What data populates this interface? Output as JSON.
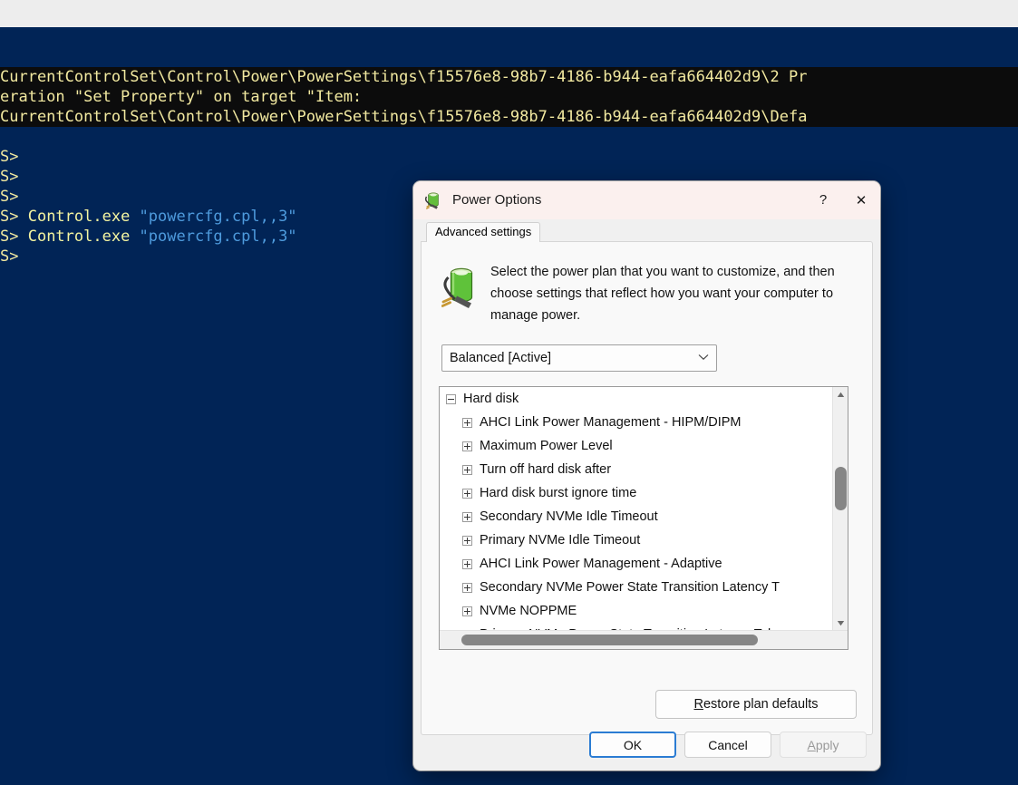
{
  "console": {
    "lines": [
      {
        "type": "error",
        "text": "CurrentControlSet\\Control\\Power\\PowerSettings\\f15576e8-98b7-4186-b944-eafa664402d9\\2 Pr"
      },
      {
        "type": "error",
        "text": "eration \"Set Property\" on target \"Item:"
      },
      {
        "type": "error",
        "text": "CurrentControlSet\\Control\\Power\\PowerSettings\\f15576e8-98b7-4186-b944-eafa664402d9\\Defa"
      },
      {
        "type": "blank",
        "text": ""
      },
      {
        "type": "prompt",
        "prompt": "S>",
        "command": "",
        "arg": ""
      },
      {
        "type": "prompt",
        "prompt": "S>",
        "command": "",
        "arg": ""
      },
      {
        "type": "prompt",
        "prompt": "S>",
        "command": "",
        "arg": ""
      },
      {
        "type": "prompt",
        "prompt": "S>",
        "command": " Control.exe ",
        "arg": "\"powercfg.cpl,,3\""
      },
      {
        "type": "prompt",
        "prompt": "S>",
        "command": " Control.exe ",
        "arg": "\"powercfg.cpl,,3\""
      },
      {
        "type": "prompt",
        "prompt": "S>",
        "command": "",
        "arg": ""
      }
    ],
    "colors": {
      "background": "#012456",
      "error_background": "#0c0c0c",
      "error_text": "#f2e9a0",
      "prompt_text": "#f2e9a0",
      "command_text": "#f4f4a0",
      "argument_text": "#4e9bdd"
    }
  },
  "dialog": {
    "title": "Power Options",
    "icon": "power-plan-icon",
    "titlebar": {
      "help_label": "?",
      "close_label": "✕"
    },
    "tabs": [
      {
        "label": "Advanced settings",
        "selected": true
      }
    ],
    "description": "Select the power plan that you want to customize, and then choose settings that reflect how you want your computer to manage power.",
    "plan_select": {
      "value": "Balanced [Active]",
      "arrow": "⌄",
      "options": [
        "Balanced [Active]"
      ]
    },
    "tree": {
      "items": [
        {
          "label": "Hard disk",
          "level": 0,
          "expander": "minus"
        },
        {
          "label": "AHCI Link Power Management - HIPM/DIPM",
          "level": 1,
          "expander": "plus"
        },
        {
          "label": "Maximum Power Level",
          "level": 1,
          "expander": "plus"
        },
        {
          "label": "Turn off hard disk after",
          "level": 1,
          "expander": "plus"
        },
        {
          "label": "Hard disk burst ignore time",
          "level": 1,
          "expander": "plus"
        },
        {
          "label": "Secondary NVMe Idle Timeout",
          "level": 1,
          "expander": "plus"
        },
        {
          "label": "Primary NVMe Idle Timeout",
          "level": 1,
          "expander": "plus"
        },
        {
          "label": "AHCI Link Power Management - Adaptive",
          "level": 1,
          "expander": "plus"
        },
        {
          "label": "Secondary NVMe Power State Transition Latency T",
          "level": 1,
          "expander": "plus"
        },
        {
          "label": "NVMe NOPPME",
          "level": 1,
          "expander": "plus"
        },
        {
          "label": "Primary NVMe Power State Transition Latency Tol",
          "level": 1,
          "expander": "plus"
        }
      ],
      "scrollbar": {
        "up_arrow": "▲",
        "down_arrow": "▼"
      }
    },
    "restore_button": {
      "accel": "R",
      "rest": "estore plan defaults"
    },
    "buttons": [
      {
        "name": "ok",
        "label": "OK",
        "default": true,
        "disabled": false
      },
      {
        "name": "cancel",
        "label": "Cancel",
        "default": false,
        "disabled": false
      },
      {
        "name": "apply",
        "accel": "A",
        "rest": "pply",
        "label": "Apply",
        "default": false,
        "disabled": true
      }
    ]
  }
}
